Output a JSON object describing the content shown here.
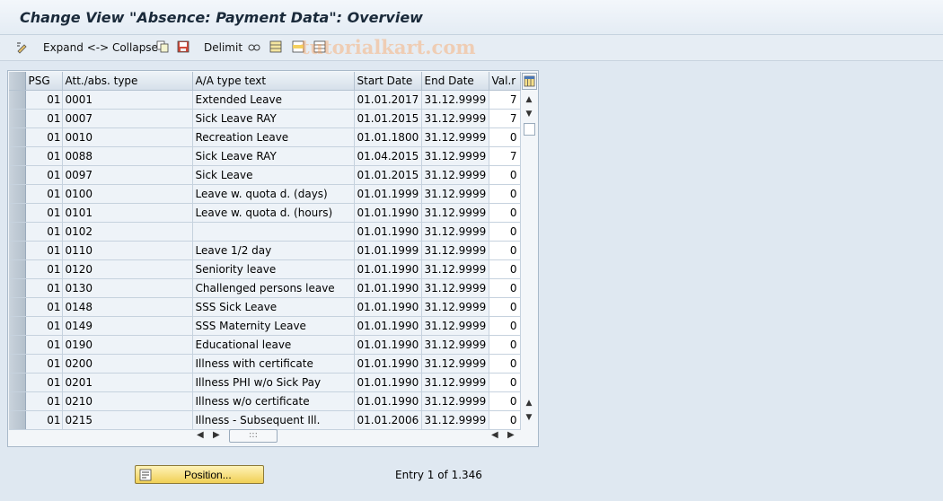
{
  "window": {
    "title": "Change View \"Absence: Payment Data\": Overview"
  },
  "toolbar": {
    "expand_collapse": "Expand <-> Collapse",
    "delimit": "Delimit",
    "icons": [
      "change-icon",
      "copy-icon",
      "save-icon",
      "delimit-icon",
      "glasses-icon",
      "select-all-icon",
      "select-block-icon",
      "deselect-icon"
    ]
  },
  "watermark": "tutorialkart.com",
  "table": {
    "columns": [
      "PSG",
      "Att./abs. type",
      "A/A type text",
      "Start Date",
      "End Date",
      "Val.r"
    ],
    "rows": [
      [
        "01",
        "0001",
        "Extended Leave",
        "01.01.2017",
        "31.12.9999",
        "7"
      ],
      [
        "01",
        "0007",
        "Sick Leave RAY",
        "01.01.2015",
        "31.12.9999",
        "7"
      ],
      [
        "01",
        "0010",
        "Recreation Leave",
        "01.01.1800",
        "31.12.9999",
        "0"
      ],
      [
        "01",
        "0088",
        "Sick Leave RAY",
        "01.04.2015",
        "31.12.9999",
        "7"
      ],
      [
        "01",
        "0097",
        "Sick Leave",
        "01.01.2015",
        "31.12.9999",
        "0"
      ],
      [
        "01",
        "0100",
        "Leave w. quota d. (days)",
        "01.01.1999",
        "31.12.9999",
        "0"
      ],
      [
        "01",
        "0101",
        "Leave w. quota d. (hours)",
        "01.01.1990",
        "31.12.9999",
        "0"
      ],
      [
        "01",
        "0102",
        "",
        "01.01.1990",
        "31.12.9999",
        "0"
      ],
      [
        "01",
        "0110",
        "Leave 1/2 day",
        "01.01.1999",
        "31.12.9999",
        "0"
      ],
      [
        "01",
        "0120",
        "Seniority leave",
        "01.01.1990",
        "31.12.9999",
        "0"
      ],
      [
        "01",
        "0130",
        "Challenged persons leave",
        "01.01.1990",
        "31.12.9999",
        "0"
      ],
      [
        "01",
        "0148",
        "SSS Sick Leave",
        "01.01.1990",
        "31.12.9999",
        "0"
      ],
      [
        "01",
        "0149",
        "SSS Maternity Leave",
        "01.01.1990",
        "31.12.9999",
        "0"
      ],
      [
        "01",
        "0190",
        "Educational leave",
        "01.01.1990",
        "31.12.9999",
        "0"
      ],
      [
        "01",
        "0200",
        "Illness with certificate",
        "01.01.1990",
        "31.12.9999",
        "0"
      ],
      [
        "01",
        "0201",
        "Illness PHI w/o Sick Pay",
        "01.01.1990",
        "31.12.9999",
        "0"
      ],
      [
        "01",
        "0210",
        "Illness w/o certificate",
        "01.01.1990",
        "31.12.9999",
        "0"
      ],
      [
        "01",
        "0215",
        "Illness - Subsequent Ill.",
        "01.01.2006",
        "31.12.9999",
        "0"
      ]
    ]
  },
  "footer": {
    "position_label": "Position...",
    "entry_text": "Entry 1 of 1.346"
  }
}
